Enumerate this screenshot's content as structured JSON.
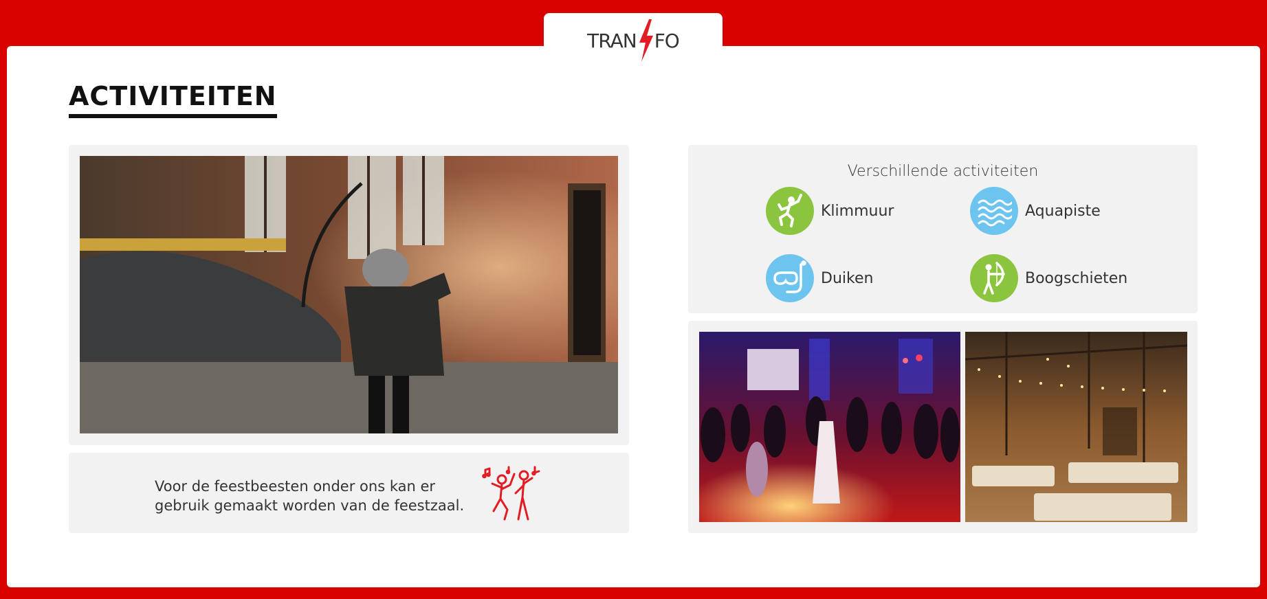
{
  "logo": {
    "left": "TRAN",
    "right": "FO",
    "accent_color": "#e31c23"
  },
  "page": {
    "title": "ACTIVITEITEN",
    "background_color": "#d90000"
  },
  "activities": {
    "title": "Verschillende activiteiten",
    "items": [
      {
        "label": "Klimmuur",
        "icon": "climbing-icon",
        "color": "#8bc53f"
      },
      {
        "label": "Aquapiste",
        "icon": "waves-icon",
        "color": "#6cc4ef"
      },
      {
        "label": "Duiken",
        "icon": "diving-mask-icon",
        "color": "#6cc4ef"
      },
      {
        "label": "Boogschieten",
        "icon": "archery-icon",
        "color": "#8bc53f"
      }
    ]
  },
  "party": {
    "text": "Voor de feestbeesten onder ons kan er gebruik gemaakt worden van de feestzaal.",
    "icon": "dancing-people-icon"
  }
}
